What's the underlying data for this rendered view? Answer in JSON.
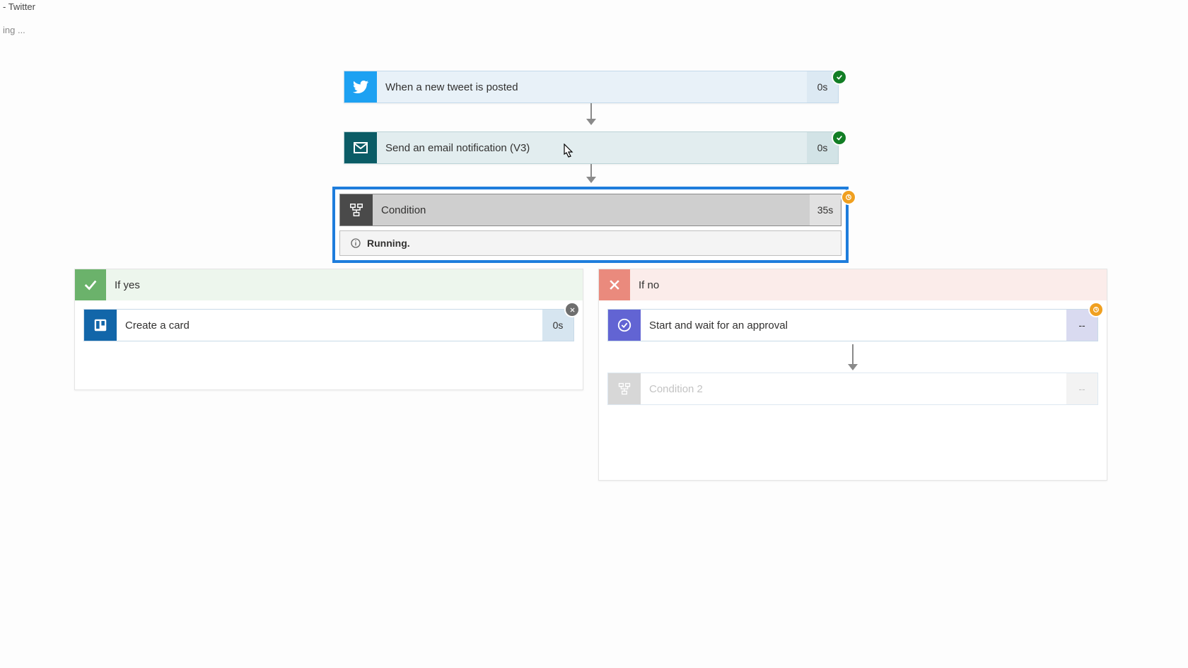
{
  "header": {
    "tab_title": "- Twitter",
    "loading_text": "ing ..."
  },
  "nodes": {
    "trigger": {
      "label": "When a new tweet is posted",
      "duration": "0s",
      "status": "success"
    },
    "email": {
      "label": "Send an email notification (V3)",
      "duration": "0s",
      "status": "success"
    },
    "condition": {
      "label": "Condition",
      "duration": "35s",
      "status": "running",
      "status_text": "Running."
    },
    "yes_branch": {
      "header": "If yes",
      "items": [
        {
          "label": "Create a card",
          "duration": "0s",
          "status": "error"
        }
      ]
    },
    "no_branch": {
      "header": "If no",
      "items": [
        {
          "label": "Start and wait for an approval",
          "duration": "--",
          "status": "running"
        },
        {
          "label": "Condition 2",
          "duration": "--",
          "status": "pending"
        }
      ]
    }
  }
}
